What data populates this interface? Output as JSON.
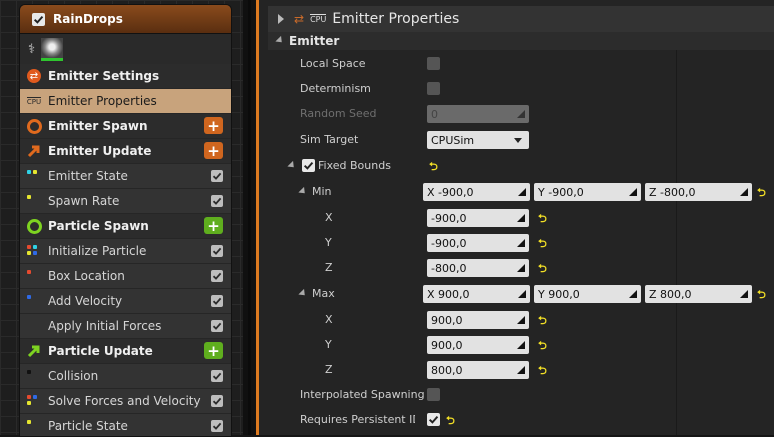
{
  "node": {
    "title": "RainDrops",
    "rows": [
      {
        "label": "Emitter Settings",
        "kind": "group",
        "icon": "emitter-settings-icon",
        "color": "#e05a1e"
      },
      {
        "label": "Emitter Properties",
        "kind": "selected",
        "icon": "cpu-icon"
      },
      {
        "label": "Emitter Spawn",
        "kind": "group",
        "icon": "ring-icon",
        "color": "#e06a1e",
        "add": "orange"
      },
      {
        "label": "Emitter Update",
        "kind": "group",
        "icon": "arrow-icon",
        "color": "#e06a1e",
        "add": "orange"
      },
      {
        "label": "Emitter State",
        "kind": "module",
        "dots": [
          "#2fd2e6",
          "#e6e62f"
        ]
      },
      {
        "label": "Spawn Rate",
        "kind": "module",
        "dots": [
          "#e6e62f"
        ]
      },
      {
        "label": "Particle Spawn",
        "kind": "group",
        "icon": "ring-icon",
        "color": "#7ed321",
        "add": "green"
      },
      {
        "label": "Initialize Particle",
        "kind": "module",
        "dots": [
          "#e64a2f",
          "#2fd2e6",
          "#e6e62f",
          "#2f6ae6"
        ]
      },
      {
        "label": "Box Location",
        "kind": "module",
        "dots": [
          "#e64a2f"
        ]
      },
      {
        "label": "Add Velocity",
        "kind": "module",
        "dots": [
          "#2f6ae6"
        ]
      },
      {
        "label": "Apply Initial Forces",
        "kind": "module",
        "dots": []
      },
      {
        "label": "Particle Update",
        "kind": "group",
        "icon": "arrow-icon",
        "color": "#7ed321",
        "add": "green"
      },
      {
        "label": "Collision",
        "kind": "module",
        "dots": [
          "#111111"
        ]
      },
      {
        "label": "Solve Forces and Velocity",
        "kind": "module",
        "dots": [
          "#e64a2f",
          "#2f6ae6",
          "#e6e62f"
        ]
      },
      {
        "label": "Particle State",
        "kind": "module",
        "dots": [
          "#e6e62f"
        ]
      }
    ]
  },
  "details": {
    "title": "Emitter Properties",
    "icon_text": "CPU",
    "category": "Emitter",
    "local_space": {
      "label": "Local Space",
      "checked": false
    },
    "determinism": {
      "label": "Determinism",
      "checked": false
    },
    "random_seed": {
      "label": "Random Seed",
      "value": "0"
    },
    "sim_target": {
      "label": "Sim Target",
      "value": "CPUSim"
    },
    "fixed_bounds": {
      "label": "Fixed Bounds",
      "checked": true
    },
    "min": {
      "label": "Min",
      "x_label": "X",
      "y_label": "Y",
      "z_label": "Z",
      "x": "-900,0",
      "y": "-900,0",
      "z": "-800,0"
    },
    "max": {
      "label": "Max",
      "x_label": "X",
      "y_label": "Y",
      "z_label": "Z",
      "x": "900,0",
      "y": "900,0",
      "z": "800,0"
    },
    "interpolated_spawning": {
      "label": "Interpolated Spawning",
      "checked": false
    },
    "requires_persistent_ids": {
      "label": "Requires Persistent IDs",
      "checked": true
    }
  }
}
